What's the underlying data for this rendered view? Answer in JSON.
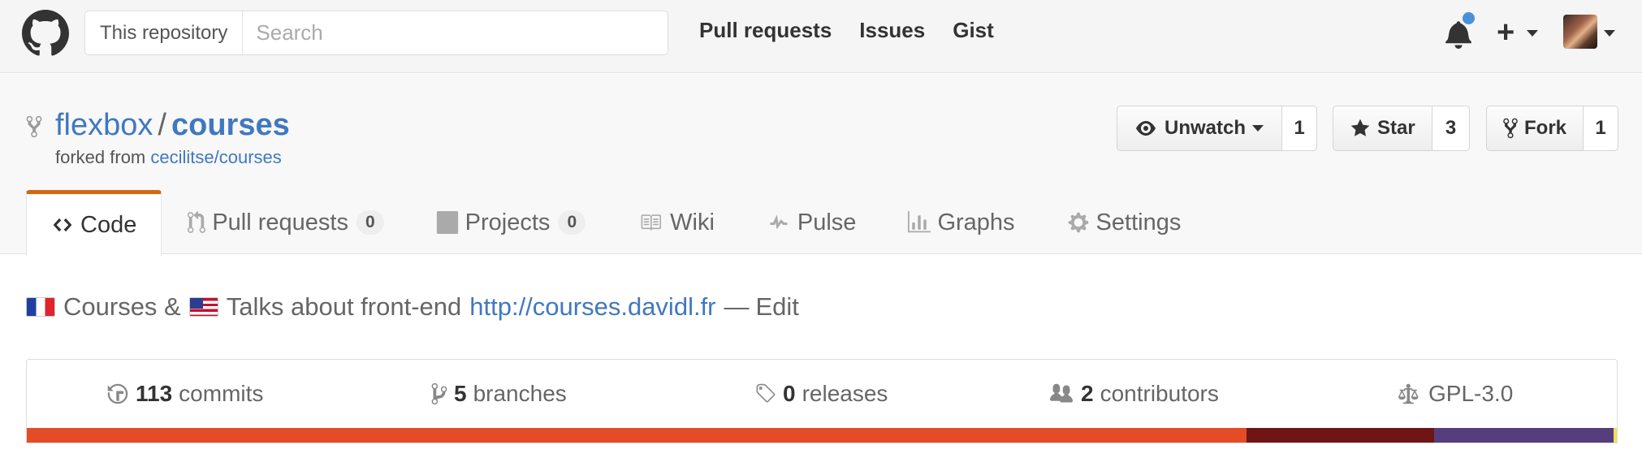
{
  "header": {
    "search_scope": "This repository",
    "search_placeholder": "Search",
    "nav": [
      "Pull requests",
      "Issues",
      "Gist"
    ]
  },
  "repo": {
    "owner": "flexbox",
    "separator": "/",
    "name": "courses",
    "forked_from_prefix": "forked from",
    "forked_from": "cecilitse/courses"
  },
  "actions": {
    "watch_label": "Unwatch",
    "watch_count": "1",
    "star_label": "Star",
    "star_count": "3",
    "fork_label": "Fork",
    "fork_count": "1"
  },
  "tabs": [
    {
      "label": "Code",
      "icon": "code-icon",
      "selected": true
    },
    {
      "label": "Pull requests",
      "icon": "pull-request-icon",
      "count": "0"
    },
    {
      "label": "Projects",
      "icon": "project-icon",
      "count": "0"
    },
    {
      "label": "Wiki",
      "icon": "book-icon"
    },
    {
      "label": "Pulse",
      "icon": "pulse-icon"
    },
    {
      "label": "Graphs",
      "icon": "graph-icon"
    },
    {
      "label": "Settings",
      "icon": "gear-icon"
    }
  ],
  "description": {
    "text_part1": "Courses &",
    "text_part2": "Talks about front-end",
    "link": "http://courses.davidl.fr",
    "dash": "—",
    "edit": "Edit"
  },
  "summary": {
    "commits_count": "113",
    "commits_label": "commits",
    "branches_count": "5",
    "branches_label": "branches",
    "releases_count": "0",
    "releases_label": "releases",
    "contributors_count": "2",
    "contributors_label": "contributors",
    "license": "GPL-3.0"
  },
  "language_bar": [
    {
      "color": "#e34c26",
      "fraction": 0.767
    },
    {
      "color": "#701516",
      "fraction": 0.118
    },
    {
      "color": "#563d7c",
      "fraction": 0.113
    },
    {
      "color": "#f1e05a",
      "fraction": 0.002
    }
  ],
  "colors": {
    "accent": "#4078c0",
    "tab_selected_border": "#d26911",
    "notification_dot": "#4a90d9"
  }
}
